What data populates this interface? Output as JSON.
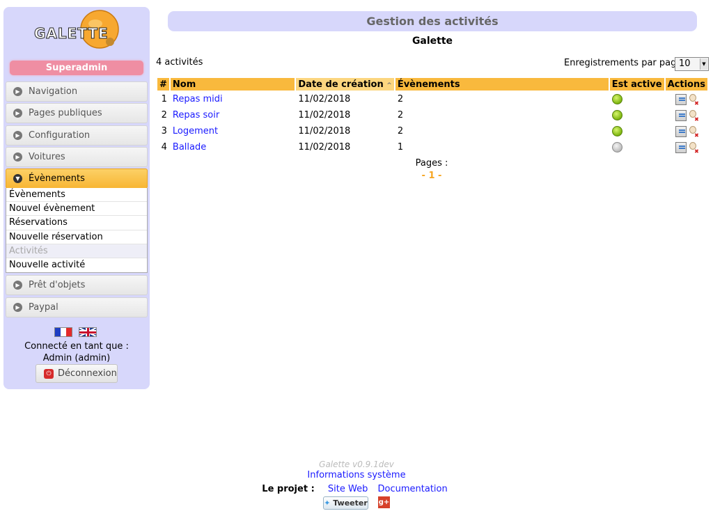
{
  "sidebar": {
    "logo_text": "GALETTE",
    "role": "Superadmin",
    "menus": [
      {
        "label": "Navigation"
      },
      {
        "label": "Pages publiques"
      },
      {
        "label": "Configuration"
      },
      {
        "label": "Voitures"
      },
      {
        "label": "Évènements"
      },
      {
        "label": "Prêt d'objets"
      },
      {
        "label": "Paypal"
      }
    ],
    "submenu": [
      {
        "label": "Évènements"
      },
      {
        "label": "Nouvel évènement"
      },
      {
        "label": "Réservations"
      },
      {
        "label": "Nouvelle réservation"
      },
      {
        "label": "Activités"
      },
      {
        "label": "Nouvelle activité"
      }
    ],
    "logged_label": "Connecté en tant que :",
    "logged_user": "Admin (admin)",
    "logout_label": "Déconnexion"
  },
  "main": {
    "title": "Gestion des activités",
    "subtitle": "Galette",
    "count": "4 activités",
    "per_page_label": "Enregistrements par page :",
    "per_page_value": "10",
    "columns": [
      "#",
      "Nom",
      "Date de création",
      "Évènements",
      "Est active",
      "Actions"
    ],
    "sort_indicator": "^",
    "rows": [
      {
        "num": "1",
        "name": "Repas midi",
        "date": "11/02/2018",
        "events": "2",
        "active": true
      },
      {
        "num": "2",
        "name": "Repas soir",
        "date": "11/02/2018",
        "events": "2",
        "active": true
      },
      {
        "num": "3",
        "name": "Logement",
        "date": "11/02/2018",
        "events": "2",
        "active": true
      },
      {
        "num": "4",
        "name": "Ballade",
        "date": "11/02/2018",
        "events": "1",
        "active": false
      }
    ],
    "pages_label": "Pages :",
    "pages_current": "- 1 -"
  },
  "footer": {
    "version": "Galette v0.9.1dev",
    "sysinfo": "Informations système",
    "project_label": "Le projet :",
    "site_web": "Site Web",
    "documentation": "Documentation",
    "tweet": "Tweeter",
    "gplus": "g+"
  },
  "colors": {
    "sidebar_bg": "#d7d7fb",
    "accent": "#f9b93d",
    "badge": "#ef8ea3",
    "link": "#1a1aff"
  }
}
